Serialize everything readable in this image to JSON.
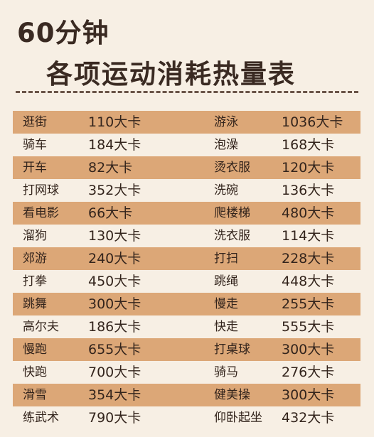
{
  "title": {
    "line1": "60分钟",
    "line2": "各项运动消耗热量表"
  },
  "rows": [
    {
      "left_activity": "逛街",
      "left_value": "110大卡",
      "right_activity": "游泳",
      "right_value": "1036大卡"
    },
    {
      "left_activity": "骑车",
      "left_value": "184大卡",
      "right_activity": "泡澡",
      "right_value": "168大卡"
    },
    {
      "left_activity": "开车",
      "left_value": "82大卡",
      "right_activity": "烫衣服",
      "right_value": "120大卡"
    },
    {
      "left_activity": "打网球",
      "left_value": "352大卡",
      "right_activity": "洗碗",
      "right_value": "136大卡"
    },
    {
      "left_activity": "看电影",
      "left_value": "66大卡",
      "right_activity": "爬楼梯",
      "right_value": "480大卡"
    },
    {
      "left_activity": "溜狗",
      "left_value": "130大卡",
      "right_activity": "洗衣服",
      "right_value": "114大卡"
    },
    {
      "left_activity": "郊游",
      "left_value": "240大卡",
      "right_activity": "打扫",
      "right_value": "228大卡"
    },
    {
      "left_activity": "打拳",
      "left_value": "450大卡",
      "right_activity": "跳绳",
      "right_value": "448大卡"
    },
    {
      "left_activity": "跳舞",
      "left_value": "300大卡",
      "right_activity": "慢走",
      "right_value": "255大卡"
    },
    {
      "left_activity": "高尔夫",
      "left_value": "186大卡",
      "right_activity": "快走",
      "right_value": "555大卡"
    },
    {
      "left_activity": "慢跑",
      "left_value": "655大卡",
      "right_activity": "打桌球",
      "right_value": "300大卡"
    },
    {
      "left_activity": "快跑",
      "left_value": "700大卡",
      "right_activity": "骑马",
      "right_value": "276大卡"
    },
    {
      "left_activity": "滑雪",
      "left_value": "354大卡",
      "right_activity": "健美操",
      "right_value": "300大卡"
    },
    {
      "left_activity": "练武术",
      "left_value": "790大卡",
      "right_activity": "仰卧起坐",
      "right_value": "432大卡"
    }
  ],
  "colors": {
    "background": "#f7efe4",
    "shaded_row": "#dca777",
    "text": "#33241c"
  }
}
